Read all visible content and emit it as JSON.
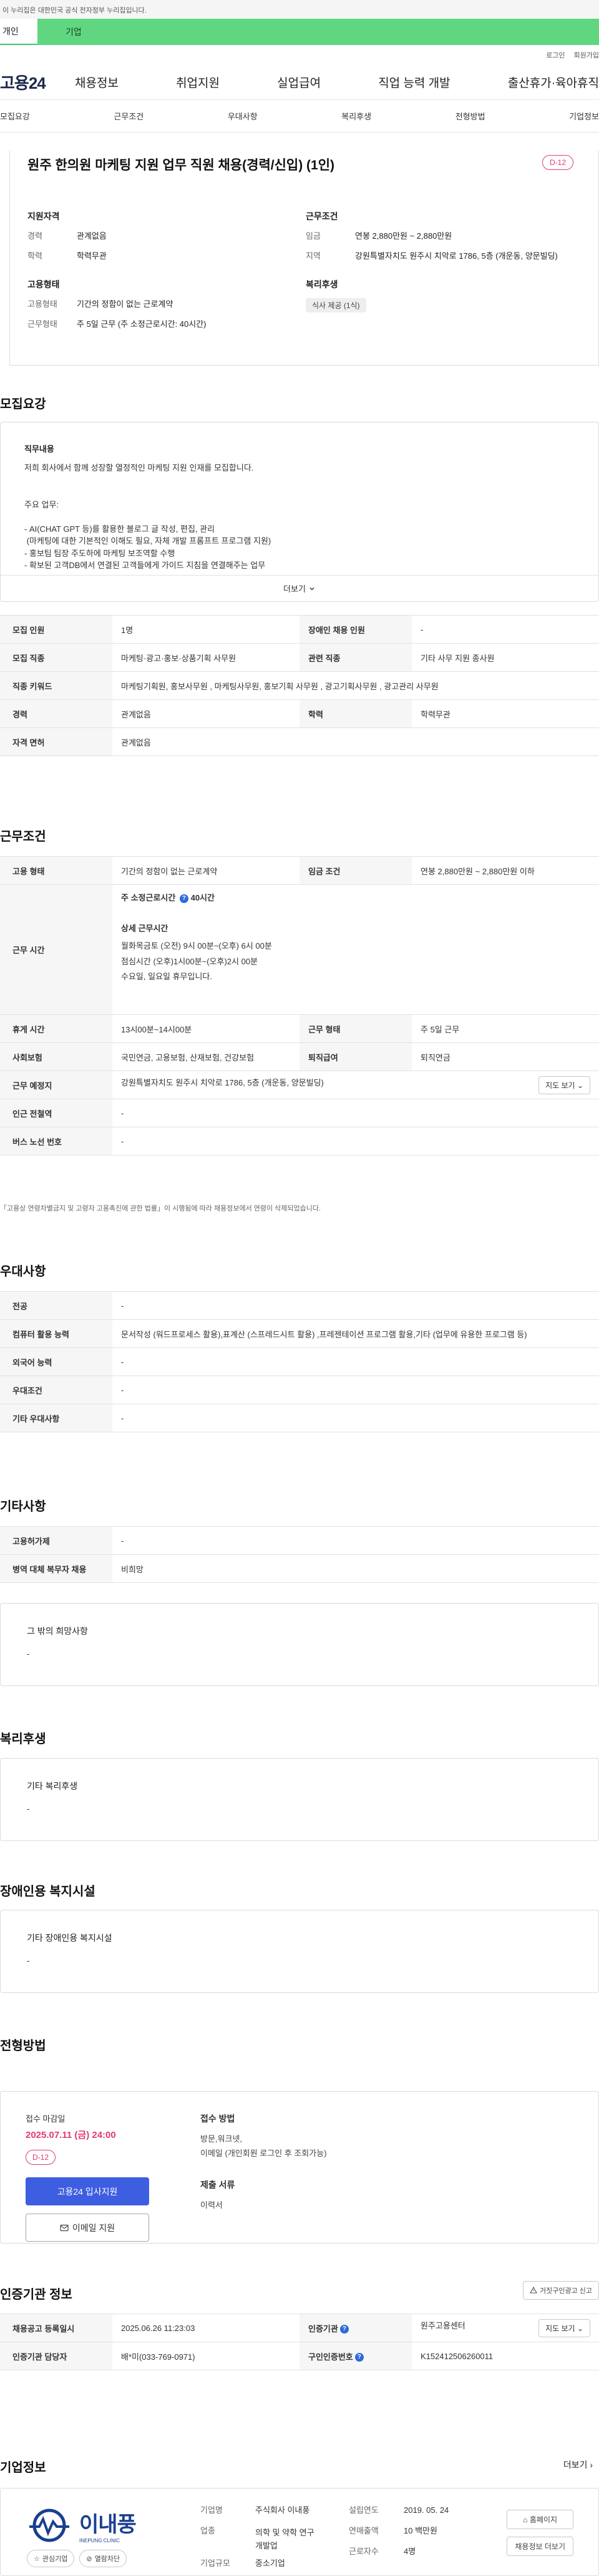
{
  "gov_banner": "이 누리집은 대한민국 공식 전자정부 누리집입니다.",
  "type_tabs": {
    "individual": "개인",
    "business": "기업"
  },
  "util": {
    "login": "로그인",
    "join": "회원가입"
  },
  "logo": "고용24",
  "gnb": [
    "채용정보",
    "취업지원",
    "실업급여",
    "직업 능력 개발",
    "출산휴가·육아휴직"
  ],
  "subnav": [
    "모집요강",
    "근무조건",
    "우대사항",
    "복리후생",
    "전형방법",
    "기업정보"
  ],
  "summary": {
    "title": "원주 한의원 마케팅 지원 업무 직원 채용(경력/신입) (1인)",
    "dday": "D-12",
    "qual_heading": "지원자격",
    "career_k": "경력",
    "career_v": "관계없음",
    "edu_k": "학력",
    "edu_v": "학력무관",
    "work_heading": "근무조건",
    "wage_k": "임금",
    "wage_v": "연봉 2,880만원 ~ 2,880만원",
    "region_k": "지역",
    "region_v": "강원특별자치도 원주시 치악로 1786, 5층 (개운동, 양문빌딩)",
    "emp_heading": "고용형태",
    "emp_type_k": "고용형태",
    "emp_type_v": "기간의 정함이 없는 근로계약",
    "hours_k": "근무형태",
    "hours_v": "주 5일 근무 (주 소정근로시간: 40시간)",
    "welfare_heading": "복리후생",
    "welfare_chip": "식사 제공 (1식)"
  },
  "sections": {
    "recruit": "모집요강",
    "conditions": "근무조건",
    "preference": "우대사항",
    "other": "기타사항",
    "welfare": "복리후생",
    "disabled": "장애인용 복지시설",
    "process": "전형방법",
    "cert": "인증기관 정보",
    "company": "기업정보"
  },
  "job_desc": {
    "heading": "직무내용",
    "text": "저희 회사에서 함께 성장할 열정적인 마케팅 지원 인재를 모집합니다.\n\n\n주요 업무:\n\n- AI(CHAT GPT 등)를 활용한 블로그 글 작성, 편집, 관리\n (마케팅에 대한 기본적인 이해도 필요, 자체 개발 프롬프트 프로그램 지원)\n- 홍보팀 팀장 주도하에 마케팅 보조역할 수행\n- 확보된 고객DB에서 연결된 고객들에게 가이드 지침을 연결해주는 업무",
    "more": "더보기"
  },
  "recruit_table": [
    [
      "모집 인원",
      "1명",
      "장애인 채용 인원",
      "-"
    ],
    [
      "모집 직종",
      "마케팅·광고·홍보·상품기획 사무원",
      "관련 직종",
      "기타 사무 지원 종사원"
    ],
    [
      "직종 키워드",
      "마케팅기획원, 홍보사무원 , 마케팅사무원, 홍보기획 사무원 , 광고기획사무원 , 광고관리 사무원",
      "",
      ""
    ],
    [
      "경력",
      "관계없음",
      "학력",
      "학력무관"
    ],
    [
      "자격 면허",
      "관계없음",
      "",
      ""
    ]
  ],
  "cond": {
    "type_k": "고용 형태",
    "type_v": "기간의 정함이 없는 근로계약",
    "wage_k": "임금 조건",
    "wage_v": "연봉 2,880만원 ~ 2,880만원 이하",
    "time_k": "근무 시간",
    "time_head": "주 소정근로시간",
    "time_hours": "40시간",
    "time_detail_head": "상세 근무시간",
    "time_detail": "월화목금토 (오전) 9시 00분~(오후) 6시 00분\n점심시간 (오후)1시00분~(오후)2시 00분\n수요일, 일요일 휴무입니다.",
    "break_k": "휴게 시간",
    "break_v": "13시00분~14시00분",
    "form_k": "근무 형태",
    "form_v": "주 5일 근무",
    "ins_k": "사회보험",
    "ins_v": "국민연금, 고용보험, 산재보험, 건강보험",
    "ret_k": "퇴직급여",
    "ret_v": "퇴직연금",
    "place_k": "근무 예정지",
    "place_v": "강원특별자치도 원주시 치악로 1786, 5층 (개운동, 양문빌딩)",
    "map_btn": "지도 보기",
    "subway_k": "인근 전철역",
    "subway_v": "-",
    "bus_k": "버스 노선 번호",
    "bus_v": "-",
    "note": "「고용상 연령차별금지 및 고령자 고용촉진에 관한 법률」이 시행됨에 따라 채용정보에서 연령이 삭제되었습니다."
  },
  "pref": [
    [
      "전공",
      "-"
    ],
    [
      "컴퓨터 활용 능력",
      "문서작성 (워드프로세스 활용),표계산 (스프레드시트 활용) ,프레젠테이션 프로그램 활용,기타 (업무에 유용한 프로그램 등)"
    ],
    [
      "외국어 능력",
      "-"
    ],
    [
      "우대조건",
      "-"
    ],
    [
      "기타 우대사항",
      "-"
    ]
  ],
  "other": [
    [
      "고용허가제",
      "-"
    ],
    [
      "병역 대체 복무자 채용",
      "비희망"
    ]
  ],
  "other_box": {
    "title": "그 밖의 희망사항",
    "value": "-"
  },
  "welfare_box": {
    "title": "기타 복리후생",
    "value": "-"
  },
  "disabled_box": {
    "title": "기타 장애인용 복지시설",
    "value": "-"
  },
  "apply": {
    "deadline_label": "접수 마감일",
    "deadline": "2025.07.11 (금) 24:00",
    "dday": "D-12",
    "apply_btn": "고용24 입사지원",
    "email_btn": "이메일 지원",
    "method_h": "접수 방법",
    "method": "방문,워크넷,\n이메일 (개인회원 로그인 후 조회가능)",
    "docs_h": "제출 서류",
    "docs": "이력서"
  },
  "cert": {
    "report_btn": "거짓구인광고 신고",
    "reg_k": "채용공고 등록일시",
    "reg_v": "2025.06.26 11:23:03",
    "org_k": "인증기관",
    "org_v": "원주고용센터",
    "map_btn": "지도 보기",
    "mgr_k": "인증기관 담당자",
    "mgr_v": "배*미(033-769-0971)",
    "no_k": "구인인증번호",
    "no_v": "K152412506260011"
  },
  "company": {
    "more": "더보기",
    "logo_text": "이내풍",
    "logo_sub": "INEPUNG CLINIC",
    "fav_btn": "관심기업",
    "block_btn": "열람차단",
    "name_k": "기업명",
    "name_v": "주식회사 이내풍",
    "ind_k": "업종",
    "ind_v": "의학 및 약학 연구\n개발업",
    "size_k": "기업규모",
    "size_v": "중소기업",
    "est_k": "설립연도",
    "est_v": "2019. 05. 24",
    "sales_k": "연매출액",
    "sales_v": "10 백만원",
    "emp_k": "근로자수",
    "emp_v": "4명",
    "home_btn": "홈페이지",
    "jobs_btn": "채용정보 더보기"
  }
}
